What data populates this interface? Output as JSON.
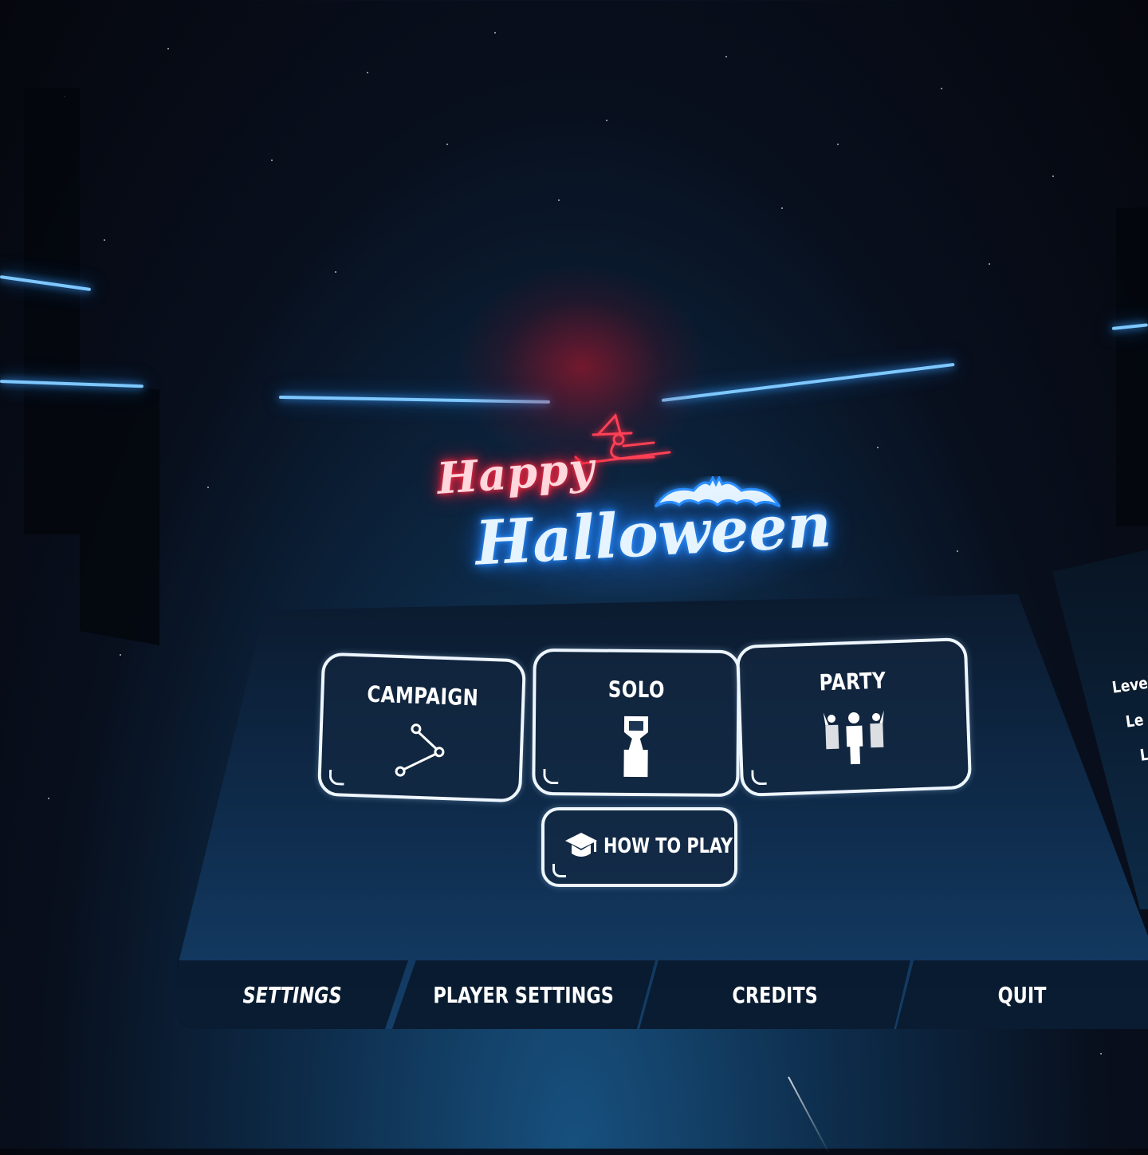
{
  "logo": {
    "line1": "Happy",
    "line2": "Halloween",
    "colors": {
      "happy": "#ff2a45",
      "halloween": "#2b8fff"
    },
    "decorations": [
      "witch-on-broom-icon",
      "bat-icon"
    ]
  },
  "main_menu": {
    "modes": [
      {
        "label": "CAMPAIGN",
        "icon": "path-nodes-icon"
      },
      {
        "label": "SOLO",
        "icon": "arcade-cabinet-icon"
      },
      {
        "label": "PARTY",
        "icon": "party-people-icon"
      }
    ],
    "how_to_play": {
      "label": "HOW TO PLAY",
      "icon": "graduation-cap-icon"
    }
  },
  "bottom_nav": [
    {
      "label": "SETTINGS"
    },
    {
      "label": "PLAYER SETTINGS"
    },
    {
      "label": "CREDITS"
    },
    {
      "label": "QUIT"
    }
  ],
  "side_panel": {
    "lines": [
      "Level",
      "Le",
      "L"
    ]
  },
  "theme": {
    "beam_color": "#7fc8ff",
    "button_border": "#eef6ff",
    "panel_bg": "#0f2d4e"
  }
}
